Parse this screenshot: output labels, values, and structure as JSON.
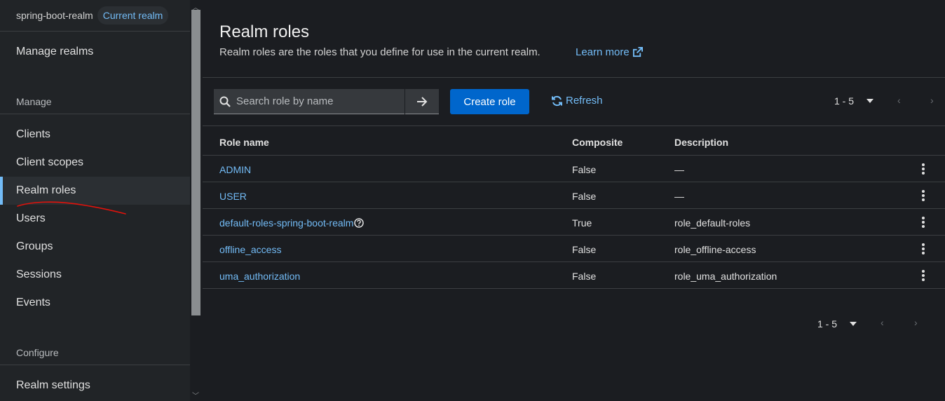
{
  "sidebar": {
    "realm_name": "spring-boot-realm",
    "realm_badge": "Current realm",
    "manage_realms": "Manage realms",
    "section_manage": "Manage",
    "items": [
      {
        "label": "Clients"
      },
      {
        "label": "Client scopes"
      },
      {
        "label": "Realm roles"
      },
      {
        "label": "Users"
      },
      {
        "label": "Groups"
      },
      {
        "label": "Sessions"
      },
      {
        "label": "Events"
      }
    ],
    "active_item": "Realm roles",
    "section_configure": "Configure",
    "realm_settings": "Realm settings"
  },
  "page": {
    "title": "Realm roles",
    "description": "Realm roles are the roles that you define for use in the current realm.",
    "learn_more": "Learn more"
  },
  "toolbar": {
    "search_placeholder": "Search role by name",
    "create_label": "Create role",
    "refresh_label": "Refresh",
    "pagination": "1 - 5"
  },
  "table": {
    "columns": [
      "Role name",
      "Composite",
      "Description"
    ],
    "rows": [
      {
        "name": "ADMIN",
        "composite": "False",
        "description": "—"
      },
      {
        "name": "USER",
        "composite": "False",
        "description": "—"
      },
      {
        "name": "default-roles-spring-boot-realm",
        "composite": "True",
        "description": "role_default-roles"
      },
      {
        "name": "offline_access",
        "composite": "False",
        "description": "role_offline-access"
      },
      {
        "name": "uma_authorization",
        "composite": "False",
        "description": "role_uma_authorization"
      }
    ]
  },
  "footer": {
    "pagination": "1 - 5"
  },
  "colors": {
    "accent": "#73bcf7",
    "primary_button": "#0066cc",
    "annotation": "#e3120b"
  }
}
